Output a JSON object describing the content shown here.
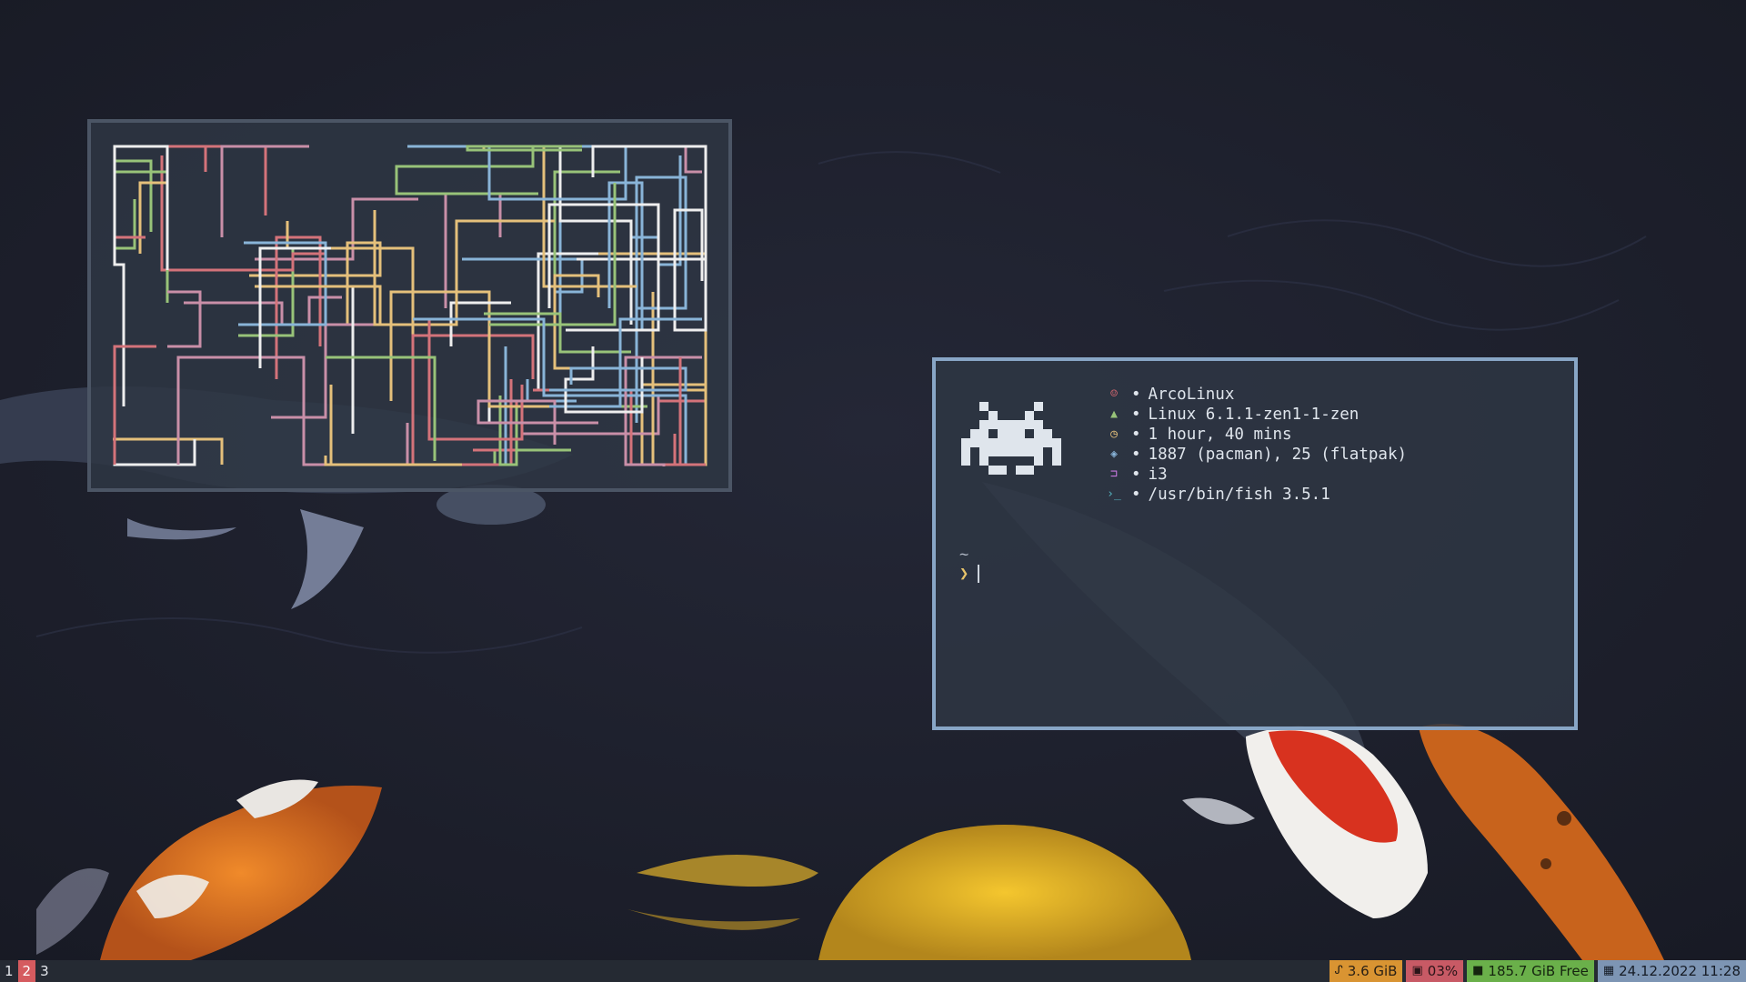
{
  "colors": {
    "pipe_colors": [
      "#e5c07b",
      "#89b4d8",
      "#d4737a",
      "#eeeeee",
      "#98c379",
      "#c98fa8"
    ],
    "workspace_focused": "#d55b5f",
    "memory": "#d99432",
    "cpu": "#c85a65",
    "disk": "#6ab04a",
    "date": "#7d95b4",
    "fetch_border": "#88a6c6",
    "pipes_border": "#4b5565"
  },
  "fetch": {
    "rows": [
      {
        "icon": "smile-icon",
        "glyph": "☺",
        "color": "#e06c75",
        "text": "ArcoLinux"
      },
      {
        "icon": "arch-icon",
        "glyph": "▲",
        "color": "#98c379",
        "text": "Linux 6.1.1-zen1-1-zen"
      },
      {
        "icon": "clock-icon",
        "glyph": "◷",
        "color": "#e5c07b",
        "text": "1 hour, 40 mins"
      },
      {
        "icon": "package-icon",
        "glyph": "◈",
        "color": "#89b4d8",
        "text": "1887 (pacman), 25 (flatpak)"
      },
      {
        "icon": "window-icon",
        "glyph": "⊐",
        "color": "#c678dd",
        "text": "i3"
      },
      {
        "icon": "shell-icon",
        "glyph": "›_",
        "color": "#56b6c2",
        "text": "/usr/bin/fish 3.5.1"
      }
    ],
    "bullet": "•"
  },
  "prompt": {
    "cwd": "~",
    "symbol": "❯"
  },
  "bar": {
    "workspaces": [
      {
        "label": "1",
        "focused": false
      },
      {
        "label": "2",
        "focused": true
      },
      {
        "label": "3",
        "focused": false
      }
    ],
    "memory": {
      "icon": "activity-icon",
      "text": "3.6 GiB"
    },
    "cpu": {
      "icon": "cpu-icon",
      "text": "03%"
    },
    "disk": {
      "icon": "folder-icon",
      "text": "185.7 GiB Free"
    },
    "date": {
      "icon": "calendar-icon",
      "text": "24.12.2022 11:28"
    }
  }
}
